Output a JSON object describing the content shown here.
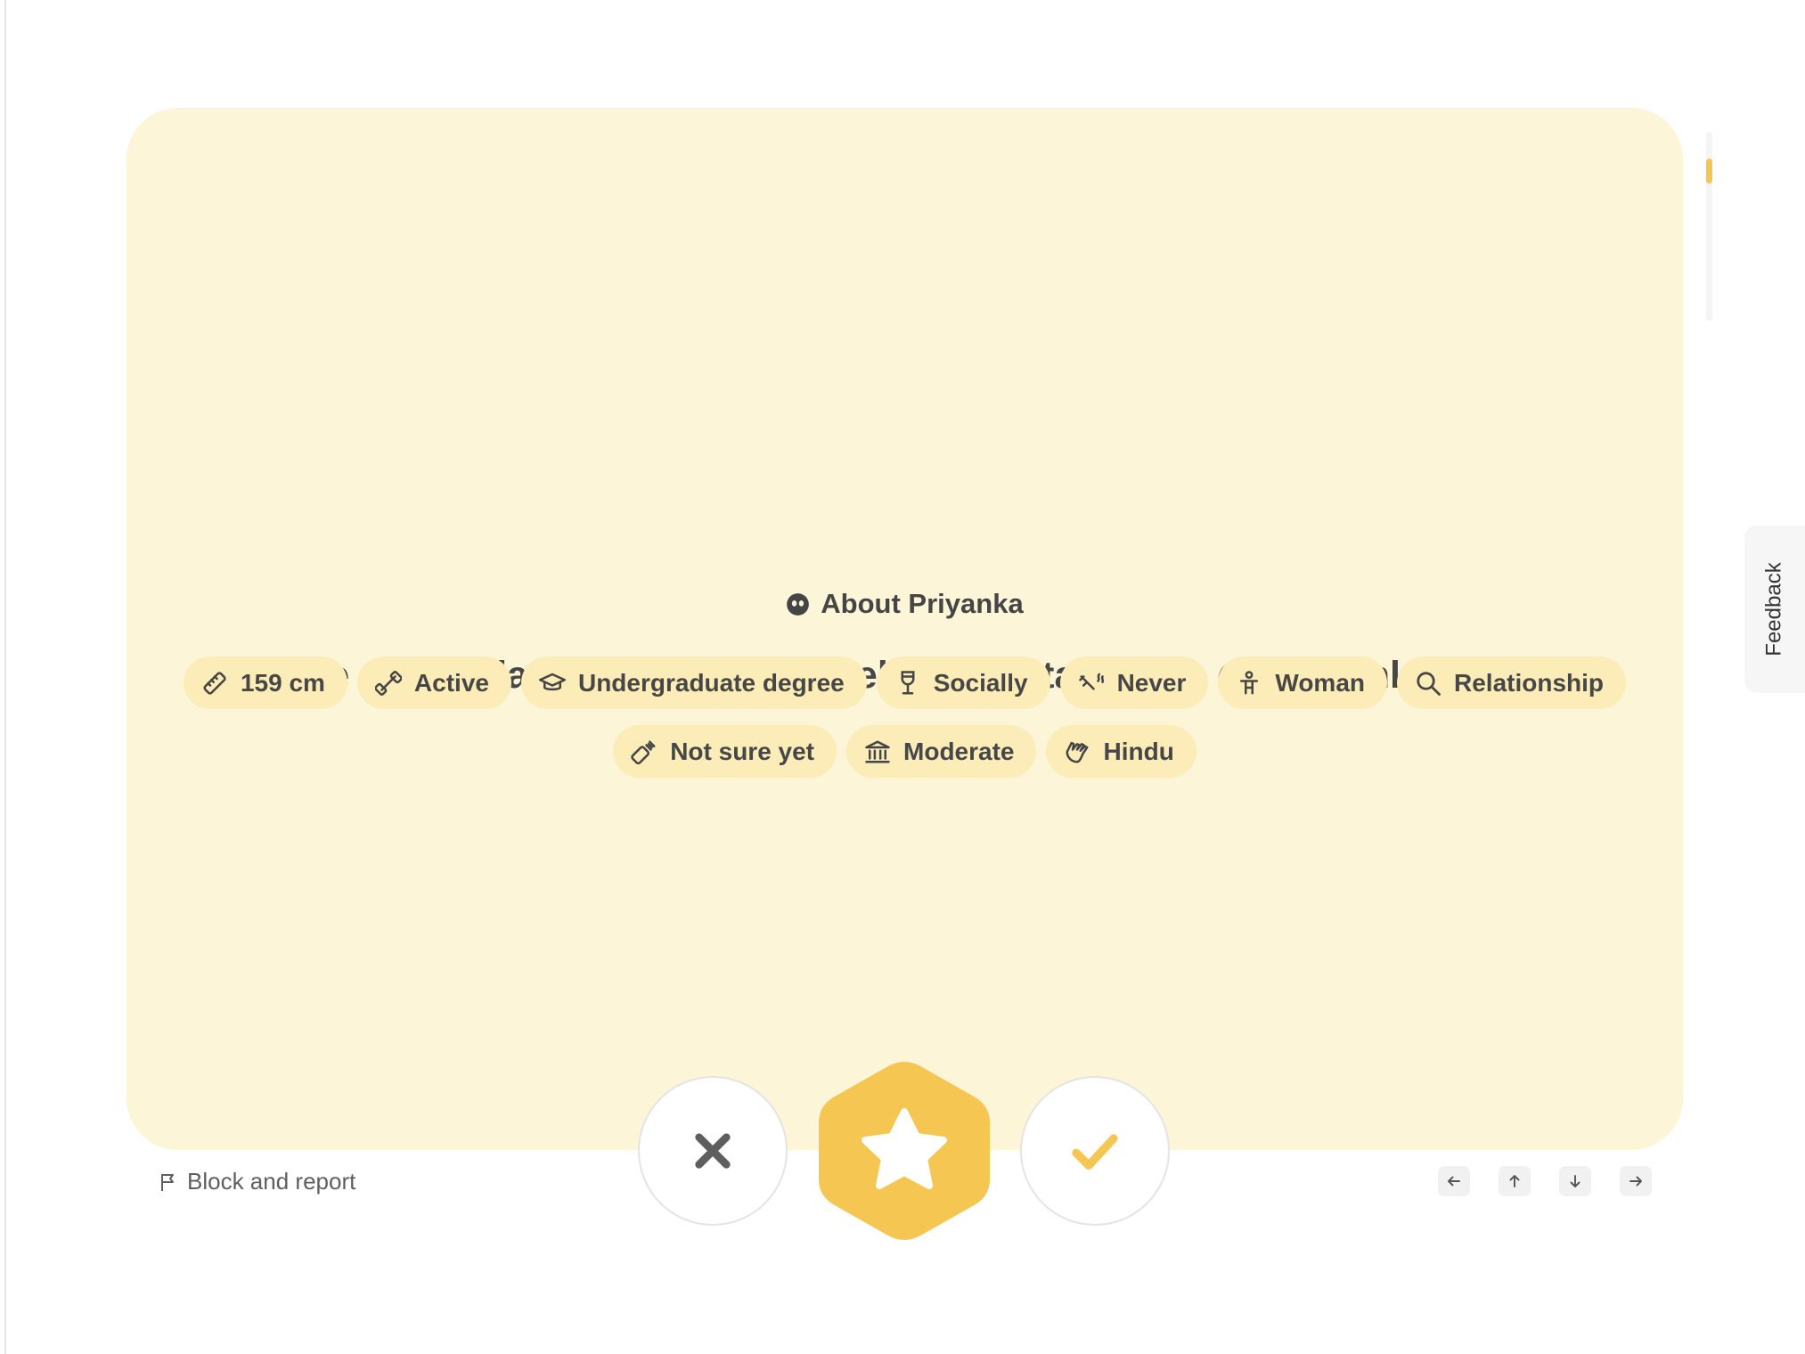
{
  "profile": {
    "about_heading": "About Priyanka",
    "bio": "I like coffee dates over anything else ☕ Instagram: - @priyaankajangid",
    "chips_row1": [
      {
        "icon": "ruler-icon",
        "label": "159 cm"
      },
      {
        "icon": "dumbbell-icon",
        "label": "Active"
      },
      {
        "icon": "graduation-cap-icon",
        "label": "Undergraduate degree"
      },
      {
        "icon": "wine-glass-icon",
        "label": "Socially"
      },
      {
        "icon": "smoking-icon",
        "label": "Never"
      },
      {
        "icon": "person-icon",
        "label": "Woman"
      },
      {
        "icon": "magnifier-icon",
        "label": "Relationship"
      }
    ],
    "chips_row2": [
      {
        "icon": "baby-bottle-icon",
        "label": "Not sure yet"
      },
      {
        "icon": "government-building-icon",
        "label": "Moderate"
      },
      {
        "icon": "praying-hands-icon",
        "label": "Hindu"
      }
    ]
  },
  "actions": {
    "pass_icon": "close-icon",
    "superswipe_icon": "star-icon",
    "like_icon": "check-icon"
  },
  "footer": {
    "block_report_label": "Block and report",
    "nav_keys": [
      "arrow-left-icon",
      "arrow-up-icon",
      "arrow-down-icon",
      "arrow-right-icon"
    ]
  },
  "feedback_label": "Feedback",
  "colors": {
    "card_background": "#fdf5d8",
    "chip_background": "#fbecb8",
    "accent_yellow": "#f5c752",
    "text_dark": "#454545"
  }
}
